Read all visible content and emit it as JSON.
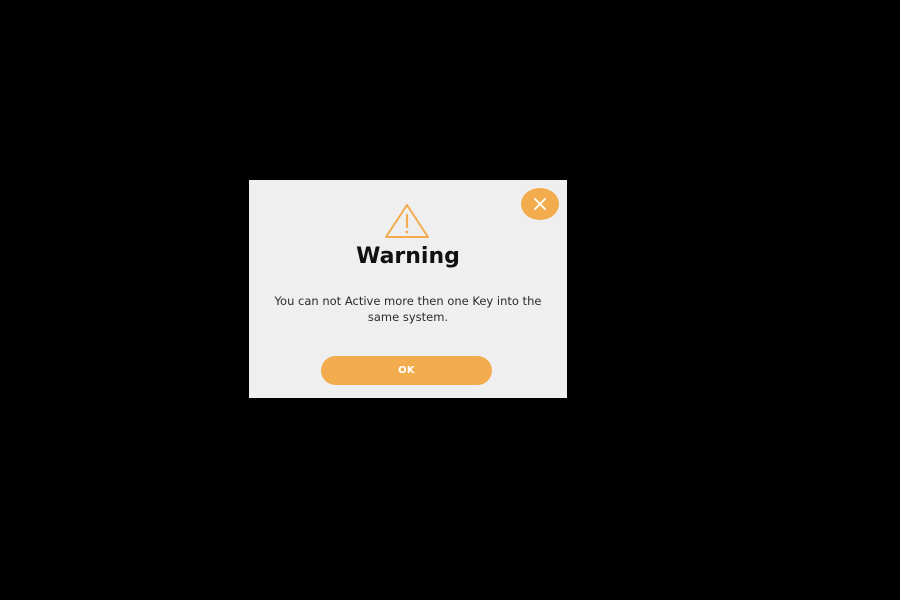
{
  "colors": {
    "accent": "#F2AC4E",
    "backdrop": "#000000",
    "dialog_background": "#EFEFEF",
    "title_text": "#111111",
    "body_text": "#2B2B2B"
  },
  "dialog": {
    "icon": "warning-triangle-icon",
    "title": "Warning",
    "message": "You can not Active more then one Key into the same system.",
    "close_icon": "close-icon",
    "ok_label": "OK"
  }
}
